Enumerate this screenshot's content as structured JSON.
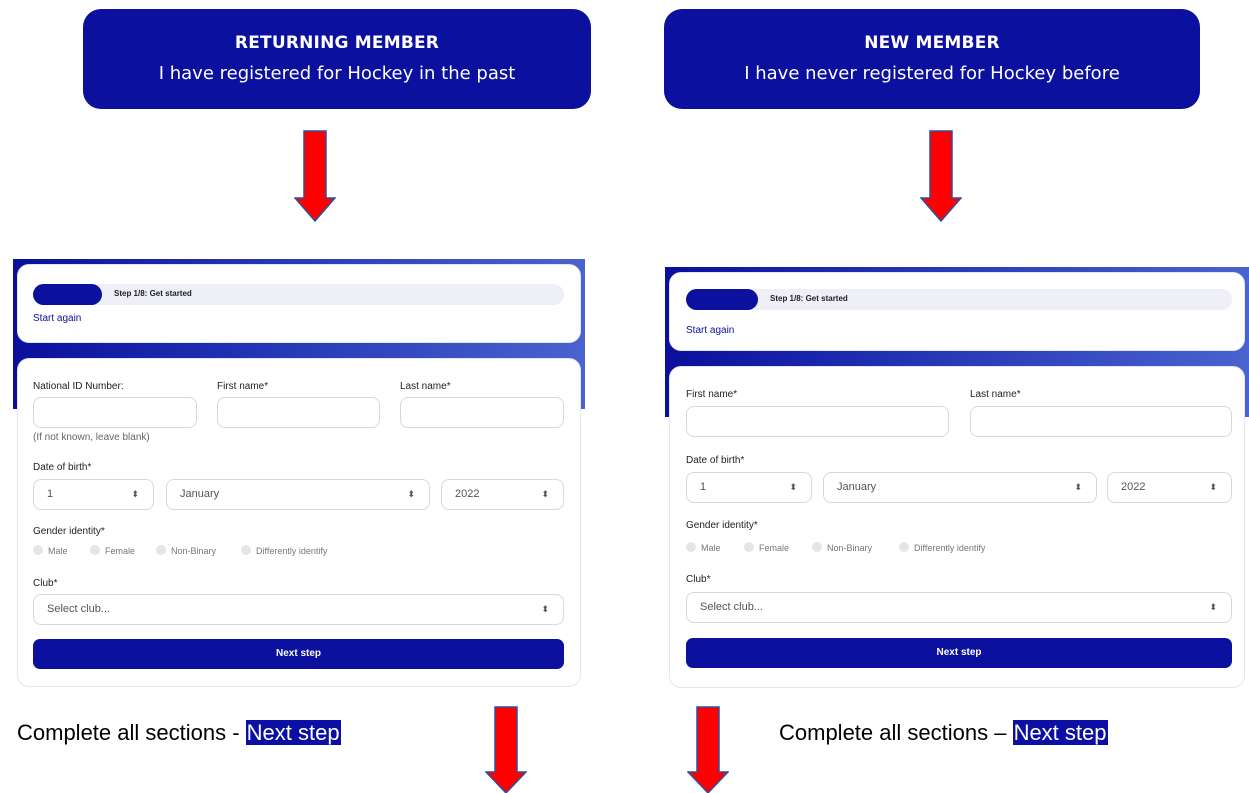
{
  "returning": {
    "heading": "RETURNING MEMBER",
    "subheading": "I have registered for Hockey in the past"
  },
  "new_member": {
    "heading": "NEW MEMBER",
    "subheading": "I have never registered for Hockey before"
  },
  "colors": {
    "accent": "#0b109f",
    "arrow": "#ff0000",
    "arrow_outline": "#2f4f9f"
  },
  "form_left": {
    "progress_label": "Step 1/8: Get started",
    "progress_fraction": 0.125,
    "start_again": "Start again",
    "national_id_label": "National ID Number:",
    "national_id_hint": "(If not known, leave blank)",
    "first_name_label": "First name*",
    "last_name_label": "Last name*",
    "dob_label": "Date of birth*",
    "dob_day": "1",
    "dob_month": "January",
    "dob_year": "2022",
    "gender_label": "Gender identity*",
    "gender_options": [
      "Male",
      "Female",
      "Non-Binary",
      "Differently identify"
    ],
    "club_label": "Club*",
    "club_placeholder": "Select club...",
    "next_button": "Next step"
  },
  "form_right": {
    "progress_label": "Step 1/8: Get started",
    "progress_fraction": 0.125,
    "start_again": "Start again",
    "first_name_label": "First name*",
    "last_name_label": "Last name*",
    "dob_label": "Date of birth*",
    "dob_day": "1",
    "dob_month": "January",
    "dob_year": "2022",
    "gender_label": "Gender identity*",
    "gender_options": [
      "Male",
      "Female",
      "Non-Binary",
      "Differently identify"
    ],
    "club_label": "Club*",
    "club_placeholder": "Select club...",
    "next_button": "Next step"
  },
  "caption_left": {
    "text": "Complete all sections - ",
    "highlight": "Next step"
  },
  "caption_right": {
    "text": "Complete all sections – ",
    "highlight": "Next step"
  }
}
